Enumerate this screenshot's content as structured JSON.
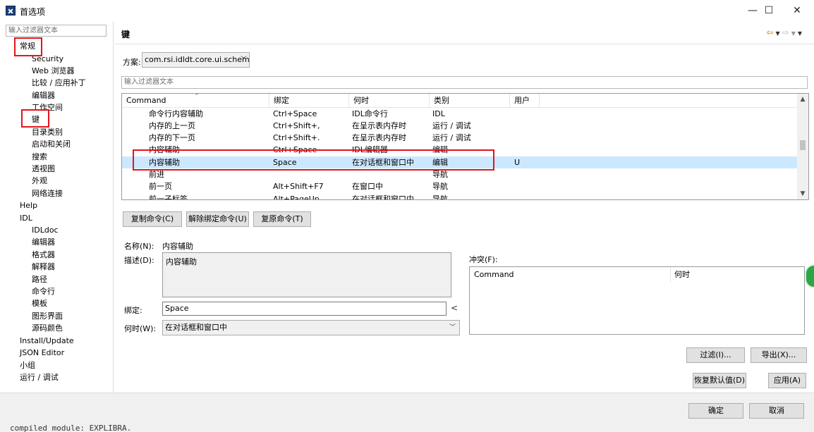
{
  "window": {
    "title": "首选项",
    "icon": "eclipse-app-icon",
    "minimize": "—",
    "maximize": "☐",
    "close": "✕"
  },
  "sidebar": {
    "filter_placeholder": "输入过滤器文本",
    "items": [
      {
        "label": "常规",
        "level": 0
      },
      {
        "label": "Security",
        "level": 1
      },
      {
        "label": "Web 浏览器",
        "level": 1
      },
      {
        "label": "比较 / 应用补丁",
        "level": 1
      },
      {
        "label": "编辑器",
        "level": 1
      },
      {
        "label": "工作空间",
        "level": 1
      },
      {
        "label": "键",
        "level": 1
      },
      {
        "label": "目录类别",
        "level": 1
      },
      {
        "label": "启动和关闭",
        "level": 1
      },
      {
        "label": "搜索",
        "level": 1
      },
      {
        "label": "透视图",
        "level": 1
      },
      {
        "label": "外观",
        "level": 1
      },
      {
        "label": "网络连接",
        "level": 1
      },
      {
        "label": "Help",
        "level": 0
      },
      {
        "label": "IDL",
        "level": 0
      },
      {
        "label": "IDLdoc",
        "level": 1
      },
      {
        "label": "编辑器",
        "level": 1
      },
      {
        "label": "格式器",
        "level": 1
      },
      {
        "label": "解释器",
        "level": 1
      },
      {
        "label": "路径",
        "level": 1
      },
      {
        "label": "命令行",
        "level": 1
      },
      {
        "label": "模板",
        "level": 1
      },
      {
        "label": "图形界面",
        "level": 1
      },
      {
        "label": "源码颜色",
        "level": 1
      },
      {
        "label": "Install/Update",
        "level": 0
      },
      {
        "label": "JSON Editor",
        "level": 0
      },
      {
        "label": "小组",
        "level": 0
      },
      {
        "label": "运行 / 调试",
        "level": 0
      }
    ]
  },
  "page": {
    "title": "键",
    "nav_icons": [
      "back-arrow-icon",
      "chevron-down-icon",
      "forward-arrow-icon",
      "chevron-down-icon",
      "view-menu-icon"
    ]
  },
  "scheme": {
    "label": "方案:",
    "value": "com.rsi.idldt.core.ui.schem"
  },
  "keys_filter_placeholder": "输入过滤器文本",
  "table": {
    "headers": [
      "Command",
      "绑定",
      "何时",
      "类别",
      "用户"
    ],
    "rows": [
      {
        "command": "命令行内容辅助",
        "binding": "Ctrl+Space",
        "when": "IDL命令行",
        "category": "IDL",
        "user": ""
      },
      {
        "command": "内存的上一页",
        "binding": "Ctrl+Shift+,",
        "when": "在呈示表内存时",
        "category": "运行 / 调试",
        "user": ""
      },
      {
        "command": "内存的下一页",
        "binding": "Ctrl+Shift+.",
        "when": "在呈示表内存时",
        "category": "运行 / 调试",
        "user": ""
      },
      {
        "command": "内容辅助",
        "binding": "Ctrl+Space",
        "when": "IDL编辑器",
        "category": "编辑",
        "user": ""
      },
      {
        "command": "内容辅助",
        "binding": "Space",
        "when": "在对话框和窗口中",
        "category": "编辑",
        "user": "U"
      },
      {
        "command": "前进",
        "binding": "",
        "when": "",
        "category": "导航",
        "user": ""
      },
      {
        "command": "前一页",
        "binding": "Alt+Shift+F7",
        "when": "在窗口中",
        "category": "导航",
        "user": ""
      },
      {
        "command": "前一子标签",
        "binding": "Alt+PageUp",
        "when": "在对话框和窗口中",
        "category": "导航",
        "user": ""
      }
    ],
    "selected_row": 4
  },
  "buttons": {
    "copy": "复制命令(C)",
    "unbind": "解除绑定命令(U)",
    "restore": "复原命令(T)",
    "filter": "过滤(I)...",
    "export": "导出(X)...",
    "restore_defaults": "恢复默认值(D)",
    "apply": "应用(A)",
    "ok": "确定",
    "cancel": "取消"
  },
  "details": {
    "name_label": "名称(N):",
    "name_value": "内容辅助",
    "desc_label": "描述(D):",
    "desc_value": "内容辅助",
    "binding_label": "绑定:",
    "binding_value": "Space",
    "binding_arrow": "<",
    "when_label": "何时(W):",
    "when_value": "在对话框和窗口中"
  },
  "conflicts": {
    "label": "冲突(F):",
    "headers": [
      "Command",
      "何时"
    ]
  },
  "background_text": "compiled module: EXPLIBRA.",
  "colors": {
    "selection": "#cce8ff",
    "highlight_box": "#e3141c",
    "nav_arrow": "#c08a00",
    "badge": "#29a744"
  }
}
